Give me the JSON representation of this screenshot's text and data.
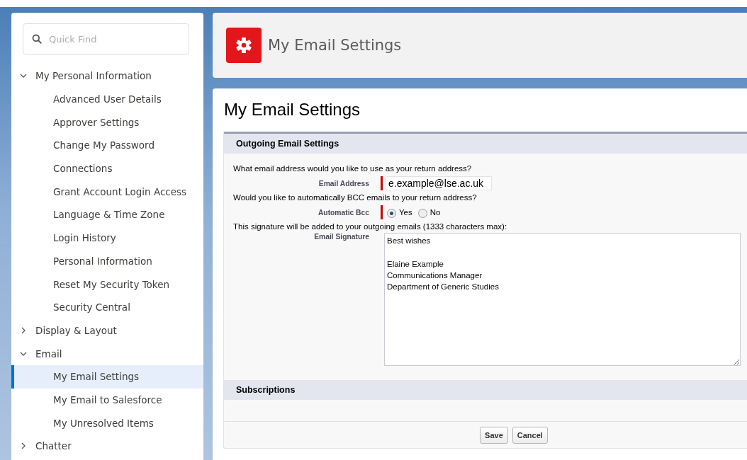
{
  "sidebar": {
    "search": {
      "placeholder": "Quick Find"
    },
    "groups": [
      {
        "label": "My Personal Information",
        "expanded": true,
        "children": [
          {
            "label": "Advanced User Details",
            "selected": false
          },
          {
            "label": "Approver Settings",
            "selected": false
          },
          {
            "label": "Change My Password",
            "selected": false
          },
          {
            "label": "Connections",
            "selected": false
          },
          {
            "label": "Grant Account Login Access",
            "selected": false
          },
          {
            "label": "Language & Time Zone",
            "selected": false
          },
          {
            "label": "Login History",
            "selected": false
          },
          {
            "label": "Personal Information",
            "selected": false
          },
          {
            "label": "Reset My Security Token",
            "selected": false
          },
          {
            "label": "Security Central",
            "selected": false
          }
        ]
      },
      {
        "label": "Display & Layout",
        "expanded": false
      },
      {
        "label": "Email",
        "expanded": true,
        "children": [
          {
            "label": "My Email Settings",
            "selected": true
          },
          {
            "label": "My Email to Salesforce",
            "selected": false
          },
          {
            "label": "My Unresolved Items",
            "selected": false
          }
        ]
      },
      {
        "label": "Chatter",
        "expanded": false
      }
    ]
  },
  "header": {
    "title": "My Email Settings"
  },
  "page": {
    "title": "My Email Settings",
    "section": {
      "title": "Outgoing Email Settings",
      "return_question": "What email address would you like to use as your return address?",
      "email_label": "Email Address",
      "email_value": "e.example@lse.ac.uk",
      "bcc_question": "Would you like to automatically BCC emails to your return address?",
      "bcc_label": "Automatic Bcc",
      "bcc_options": [
        {
          "label": "Yes",
          "selected": true
        },
        {
          "label": "No",
          "selected": false
        }
      ],
      "signature_note": "This signature will be added to your outgoing emails (1333 characters max):",
      "signature_label": "Email Signature",
      "signature_value": "Best wishes\n\nElaine Example\nCommunications Manager\nDepartment of Generic Studies"
    },
    "subscriptions_title": "Subscriptions",
    "buttons": [
      "Save",
      "Cancel"
    ]
  }
}
